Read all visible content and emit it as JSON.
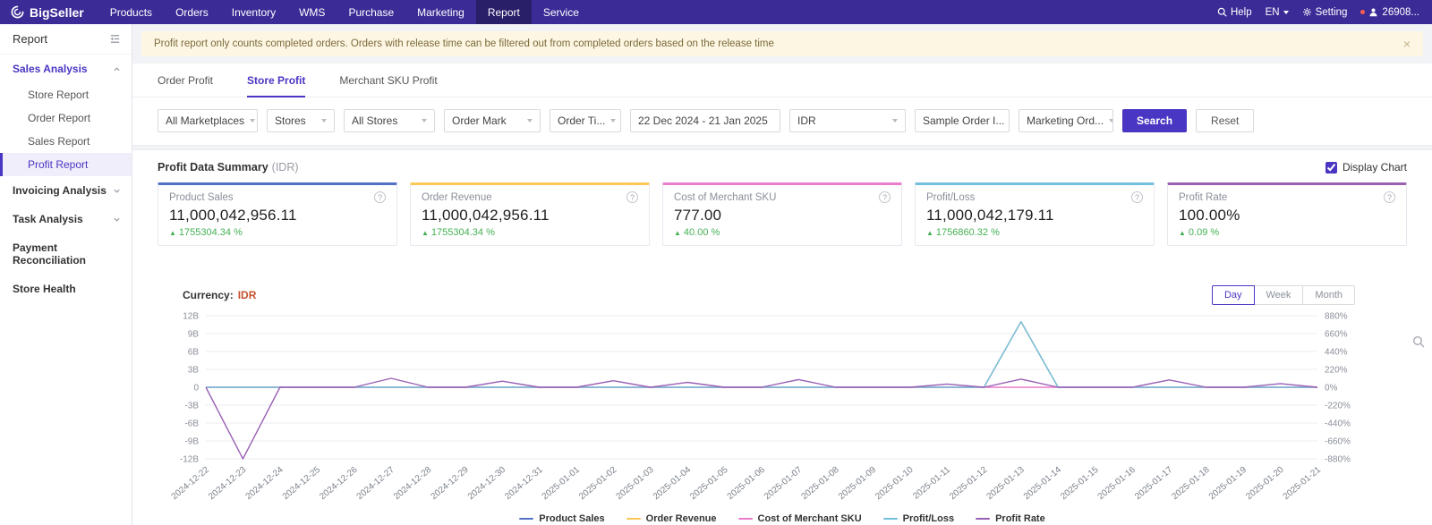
{
  "nav": {
    "brand": "BigSeller",
    "items": [
      "Products",
      "Orders",
      "Inventory",
      "WMS",
      "Purchase",
      "Marketing",
      "Report",
      "Service"
    ],
    "active": "Report",
    "help": "Help",
    "lang": "EN",
    "setting": "Setting",
    "user": "26908..."
  },
  "sidebar": {
    "title": "Report",
    "sections": [
      {
        "label": "Sales Analysis",
        "chevron": "up",
        "active": true,
        "children": [
          {
            "label": "Store Report"
          },
          {
            "label": "Order Report"
          },
          {
            "label": "Sales Report"
          },
          {
            "label": "Profit Report",
            "active": true
          }
        ]
      },
      {
        "label": "Invoicing Analysis",
        "chevron": "down"
      },
      {
        "label": "Task Analysis",
        "chevron": "down"
      },
      {
        "label": "Payment Reconciliation"
      },
      {
        "label": "Store Health"
      }
    ]
  },
  "banner": {
    "text": "Profit report only counts completed orders. Orders with release time can be filtered out from completed orders based on the release time",
    "close": "×"
  },
  "tabs": [
    {
      "label": "Order Profit"
    },
    {
      "label": "Store Profit",
      "active": true
    },
    {
      "label": "Merchant SKU Profit"
    }
  ],
  "filters": {
    "marketplaces": "All Marketplaces",
    "stores": "Stores",
    "all_stores": "All Stores",
    "order_mark": "Order Mark",
    "order_time": "Order Ti...",
    "date_range": "22 Dec 2024  -  21 Jan 2025",
    "currency": "IDR",
    "sample_order": "Sample Order I...",
    "marketing_order": "Marketing Ord...",
    "search": "Search",
    "reset": "Reset"
  },
  "summary": {
    "title": "Profit Data Summary",
    "suffix": "(IDR)",
    "display_chart": "Display Chart",
    "cards": [
      {
        "label": "Product Sales",
        "value": "11,000,042,956.11",
        "change": "1755304.34 %",
        "color": "#5470c6"
      },
      {
        "label": "Order Revenue",
        "value": "11,000,042,956.11",
        "change": "1755304.34 %",
        "color": "#fac858"
      },
      {
        "label": "Cost of Merchant SKU",
        "value": "777.00",
        "change": "40.00 %",
        "color": "#ea7ccc"
      },
      {
        "label": "Profit/Loss",
        "value": "11,000,042,179.11",
        "change": "1756860.32 %",
        "color": "#73c0de"
      },
      {
        "label": "Profit Rate",
        "value": "100.00%",
        "change": "0.09 %",
        "color": "#9a60b4"
      }
    ]
  },
  "chart_controls": {
    "currency_label": "Currency:",
    "currency_value": "IDR",
    "periods": [
      {
        "label": "Day",
        "active": true
      },
      {
        "label": "Week"
      },
      {
        "label": "Month"
      }
    ]
  },
  "chart_data": {
    "type": "line",
    "title": "Profit Data Summary (IDR)",
    "legend_position": "bottom",
    "grid": true,
    "x": [
      "2024-12-22",
      "2024-12-23",
      "2024-12-24",
      "2024-12-25",
      "2024-12-26",
      "2024-12-27",
      "2024-12-28",
      "2024-12-29",
      "2024-12-30",
      "2024-12-31",
      "2025-01-01",
      "2025-01-02",
      "2025-01-03",
      "2025-01-04",
      "2025-01-05",
      "2025-01-06",
      "2025-01-07",
      "2025-01-08",
      "2025-01-09",
      "2025-01-10",
      "2025-01-11",
      "2025-01-12",
      "2025-01-13",
      "2025-01-14",
      "2025-01-15",
      "2025-01-16",
      "2025-01-17",
      "2025-01-18",
      "2025-01-19",
      "2025-01-20",
      "2025-01-21"
    ],
    "left_axis": {
      "ticks": [
        "12B",
        "9B",
        "6B",
        "3B",
        "0",
        "-3B",
        "-6B",
        "-9B",
        "-12B"
      ],
      "max": 12000000000,
      "min": -12000000000
    },
    "right_axis": {
      "ticks": [
        "880%",
        "660%",
        "440%",
        "220%",
        "0%",
        "-220%",
        "-440%",
        "-660%",
        "-880%"
      ],
      "max": 880,
      "min": -880
    },
    "series": [
      {
        "name": "Product Sales",
        "color": "#5470c6",
        "axis": "left",
        "values": [
          0,
          0,
          0,
          0,
          0,
          0,
          0,
          0,
          0,
          0,
          0,
          0,
          0,
          0,
          0,
          0,
          0,
          0,
          0,
          0,
          0,
          0,
          11000042956.11,
          0,
          0,
          0,
          0,
          0,
          0,
          0,
          0
        ]
      },
      {
        "name": "Order Revenue",
        "color": "#fac858",
        "axis": "left",
        "values": [
          0,
          0,
          0,
          0,
          0,
          0,
          0,
          0,
          0,
          0,
          0,
          0,
          0,
          0,
          0,
          0,
          0,
          0,
          0,
          0,
          0,
          0,
          11000042956.11,
          0,
          0,
          0,
          0,
          0,
          0,
          0,
          0
        ]
      },
      {
        "name": "Cost of Merchant SKU",
        "color": "#ea7ccc",
        "axis": "left",
        "values": [
          0,
          0,
          0,
          0,
          0,
          0,
          0,
          0,
          0,
          0,
          0,
          0,
          0,
          0,
          0,
          0,
          0,
          0,
          0,
          0,
          0,
          0,
          777,
          0,
          0,
          0,
          0,
          0,
          0,
          0,
          0
        ]
      },
      {
        "name": "Profit/Loss",
        "color": "#73c0de",
        "axis": "left",
        "values": [
          0,
          0,
          0,
          0,
          0,
          0,
          0,
          0,
          0,
          0,
          0,
          0,
          0,
          0,
          0,
          0,
          0,
          0,
          0,
          0,
          0,
          0,
          11000042179.11,
          0,
          0,
          0,
          0,
          0,
          0,
          0,
          0
        ]
      },
      {
        "name": "Profit Rate",
        "color": "#9a60b4",
        "axis": "right",
        "values": [
          0,
          -880,
          0,
          0,
          0,
          110,
          0,
          0,
          75,
          0,
          0,
          80,
          0,
          60,
          0,
          0,
          95,
          0,
          0,
          0,
          40,
          0,
          100,
          0,
          0,
          0,
          90,
          0,
          0,
          45,
          0
        ]
      }
    ]
  }
}
